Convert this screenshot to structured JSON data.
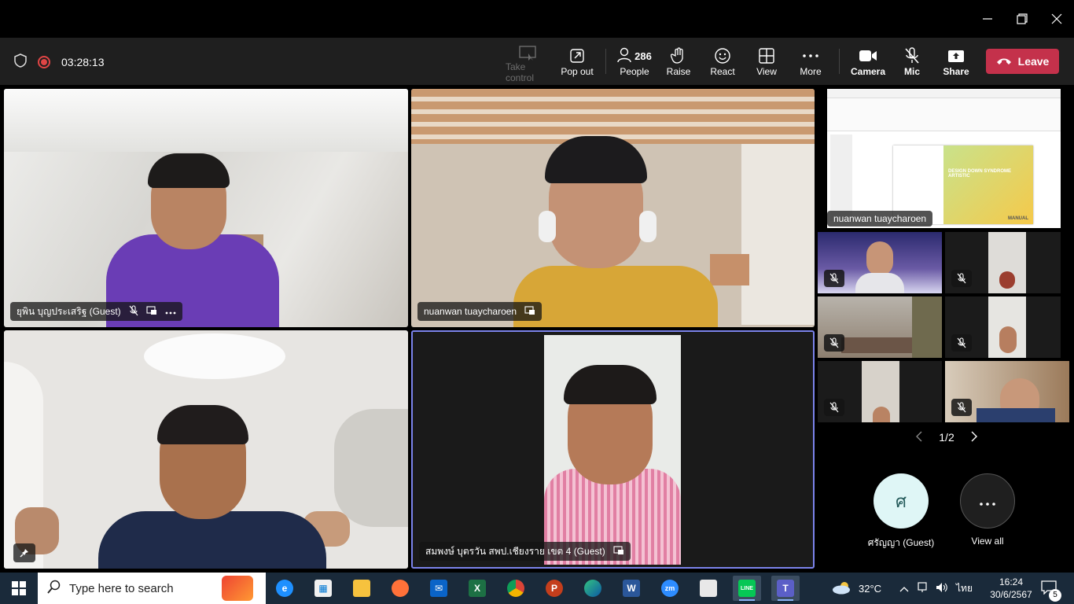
{
  "meeting": {
    "timer": "03:28:13"
  },
  "toolbar": {
    "take_control": "Take control",
    "pop_out": "Pop out",
    "people_count": "286",
    "people": "People",
    "raise": "Raise",
    "react": "React",
    "view": "View",
    "more": "More",
    "camera": "Camera",
    "mic": "Mic",
    "share": "Share",
    "leave": "Leave"
  },
  "tiles": [
    {
      "name": "ยุพิน บุญประเสริฐ (Guest)",
      "bg": "#d9d9d4"
    },
    {
      "name": "nuanwan tuaycharoen",
      "bg": "#c9b9a6"
    },
    {
      "name": "",
      "bg": "#e6e4e1"
    },
    {
      "name": "สมพงษ์ บุตรวัน สพป.เชียงราย เขต 4 (Guest)",
      "bg": "#1a1a1a"
    }
  ],
  "sidebar": {
    "shared_screen_name": "nuanwan tuaycharoen",
    "shared_slide_title": "DESIGN DOWN SYNDROME ARTISTIC",
    "shared_slide_footer": "MANUAL",
    "pager": "1/2",
    "avatar_initial": "ศ",
    "avatar_name": "ศรัญญา (Guest)",
    "view_all": "View all"
  },
  "taskbar": {
    "search_placeholder": "Type here to search",
    "weather": "32°C",
    "language": "ไทย",
    "time": "16:24",
    "date": "30/6/2567",
    "notifications": "5"
  },
  "colors": {
    "leave": "#c4314b",
    "record": "#e04545",
    "active_tile_border": "#7b83eb",
    "avatar_bg": "#dff6f6"
  }
}
